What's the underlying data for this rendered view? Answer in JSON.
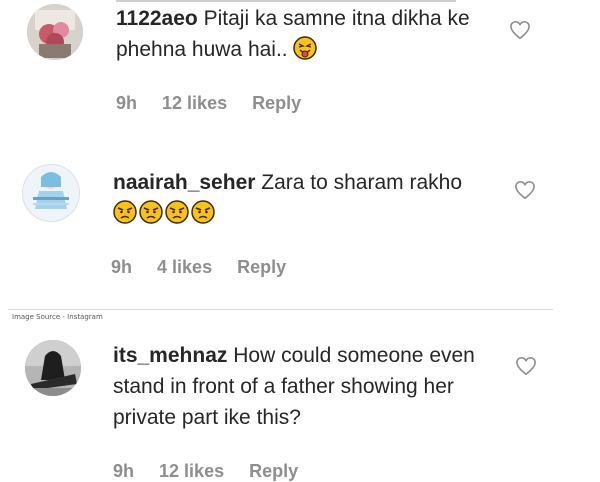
{
  "comments": [
    {
      "username": "1122aeo",
      "text": "Pitaji ka samne itna dikha ke phehna huwa hai..",
      "emojis": [
        "tongue-wink-emoji"
      ],
      "time": "9h",
      "likes": "12 likes",
      "reply": "Reply"
    },
    {
      "username": "naairah_seher",
      "text": "Zara to sharam rakho",
      "emojis": [
        "angry-emoji",
        "angry-emoji",
        "angry-emoji",
        "angry-emoji"
      ],
      "time": "9h",
      "likes": "4 likes",
      "reply": "Reply"
    },
    {
      "username": "its_mehnaz",
      "text": "How could someone even stand in front of a father showing her private part ike this?",
      "emojis": [],
      "time": "9h",
      "likes": "12 likes",
      "reply": "Reply"
    }
  ],
  "image_source": "Image Source - Instagram",
  "colors": {
    "text": "#262626",
    "meta": "#8e8e8e",
    "emoji_fill": "#f9c21b",
    "emoji_outline": "#3d2a00"
  }
}
